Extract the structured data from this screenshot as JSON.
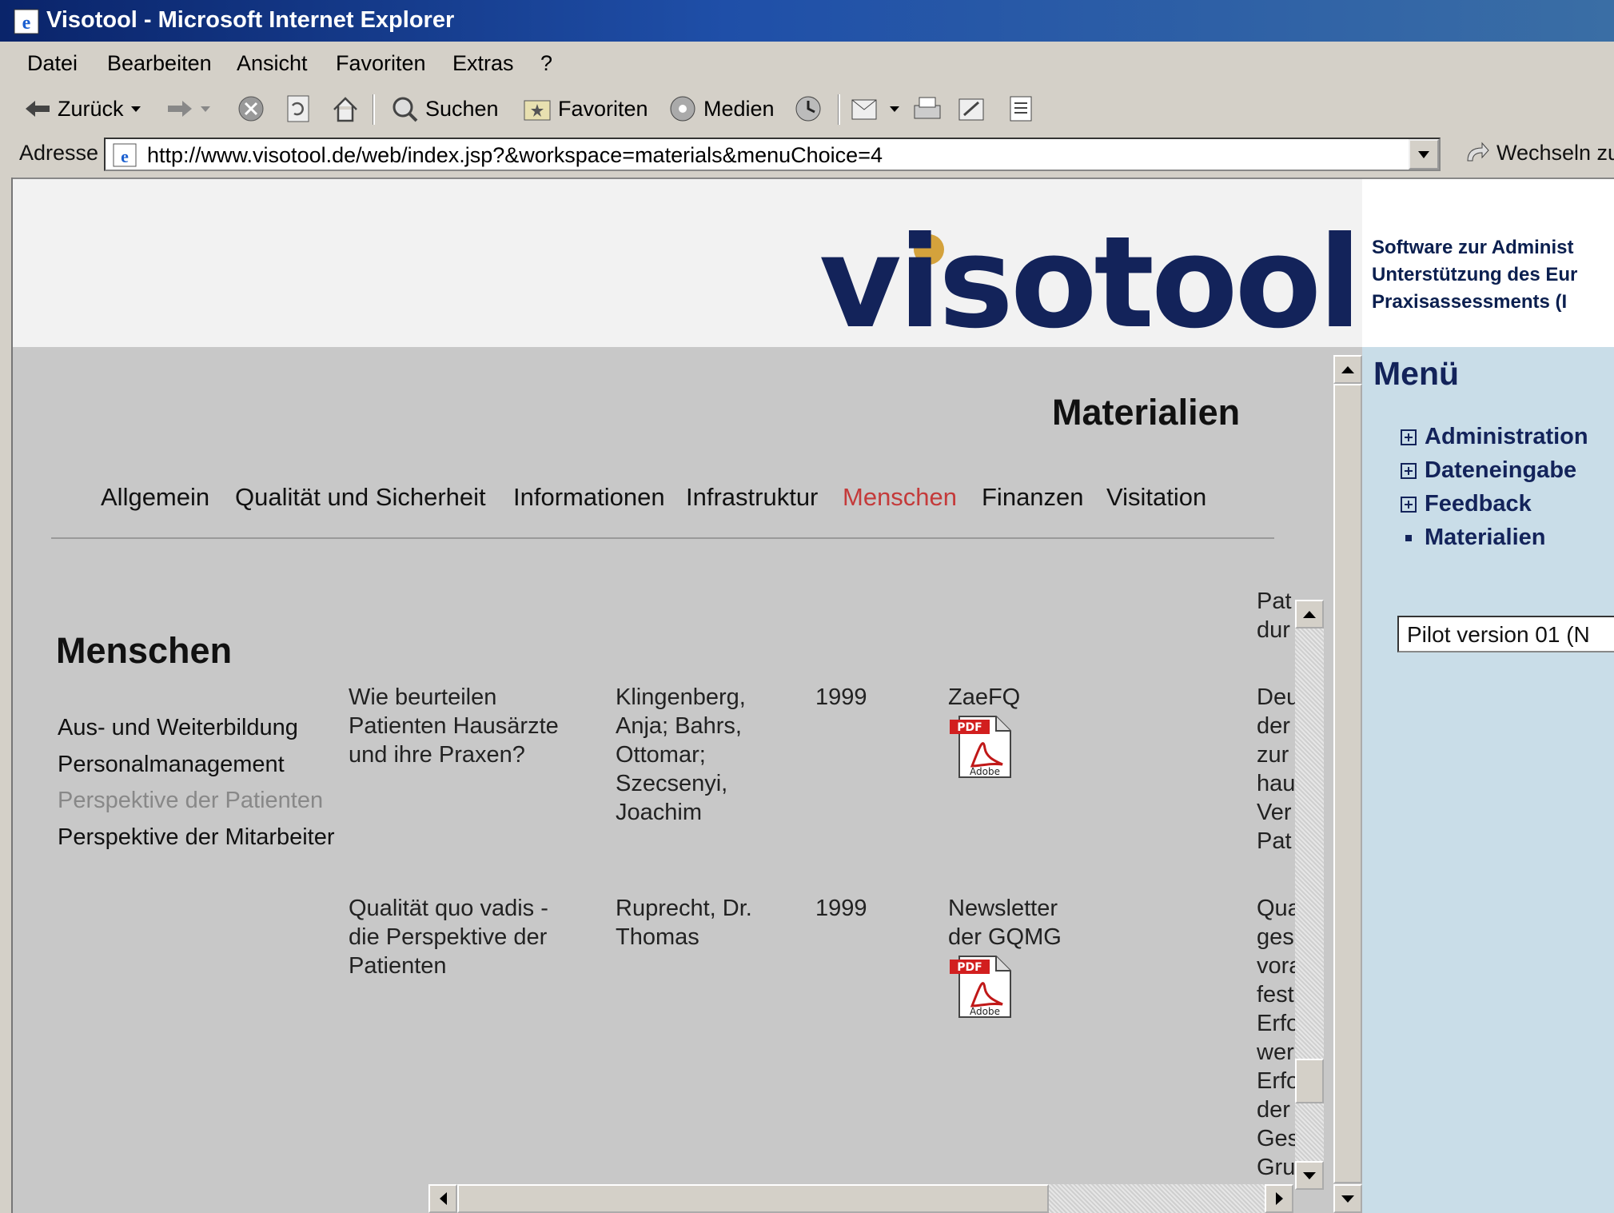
{
  "window": {
    "title": "Visotool - Microsoft Internet Explorer"
  },
  "menubar": [
    "Datei",
    "Bearbeiten",
    "Ansicht",
    "Favoriten",
    "Extras",
    "?"
  ],
  "toolbar": {
    "back": "Zurück",
    "search": "Suchen",
    "favorites": "Favoriten",
    "media": "Medien"
  },
  "addressbar": {
    "label": "Adresse",
    "url": "http://www.visotool.de/web/index.jsp?&workspace=materials&menuChoice=4",
    "go": "Wechseln zu"
  },
  "header": {
    "logo": "visotool",
    "tagline": [
      "Software zur Administ",
      "Unterstützung des Eur",
      "Praxisassessments (I"
    ]
  },
  "page": {
    "title": "Materialien",
    "tabs": [
      "Allgemein",
      "Qualität und Sicherheit",
      "Informationen",
      "Infrastruktur",
      "Menschen",
      "Finanzen",
      "Visitation"
    ],
    "section_title": "Menschen",
    "subnav": [
      "Aus- und Weiterbildung",
      "Personalmanagement",
      "Perspektive der Patienten",
      "Perspektive der Mitarbeiter"
    ],
    "top_desc_fragment": [
      "Pat",
      "dur"
    ],
    "rows": [
      {
        "title": [
          "Wie beurteilen",
          "Patienten Hausärzte",
          "und ihre Praxen?"
        ],
        "authors": [
          "Klingenberg,",
          "Anja; Bahrs,",
          "Ottomar;",
          "Szecsenyi,",
          "Joachim"
        ],
        "year": "1999",
        "source": [
          "ZaeFQ"
        ],
        "desc": [
          "Deu",
          "der",
          "zur",
          "hau",
          "Ver",
          "Pat"
        ]
      },
      {
        "title": [
          "Qualität quo vadis -",
          "die Perspektive der",
          "Patienten"
        ],
        "authors": [
          "Ruprecht, Dr.",
          "Thomas"
        ],
        "year": "1999",
        "source": [
          "Newsletter",
          "der GQMG"
        ],
        "desc": [
          "Qua",
          "ges",
          "vora",
          "fest",
          "Erfo",
          "wer",
          "Erfo",
          "der",
          "Ges",
          "Gru"
        ]
      }
    ],
    "pdf_icon": {
      "badge": "PDF",
      "brand": "Adobe"
    }
  },
  "sidebar": {
    "title": "Menü",
    "items": [
      {
        "label": "Administration",
        "icon": "plus-box-icon"
      },
      {
        "label": "Dateneingabe",
        "icon": "plus-box-icon"
      },
      {
        "label": "Feedback",
        "icon": "plus-box-icon"
      },
      {
        "label": "Materialien",
        "icon": "bullet-icon"
      }
    ],
    "version_select": "Pilot version 01 (N"
  },
  "colors": {
    "active_tab": "#c43a3a",
    "logo_navy": "#13235a",
    "logo_dot": "#d4a23c",
    "sidebar_bg": "#c9dde8",
    "content_bg": "#c8c8c8"
  }
}
